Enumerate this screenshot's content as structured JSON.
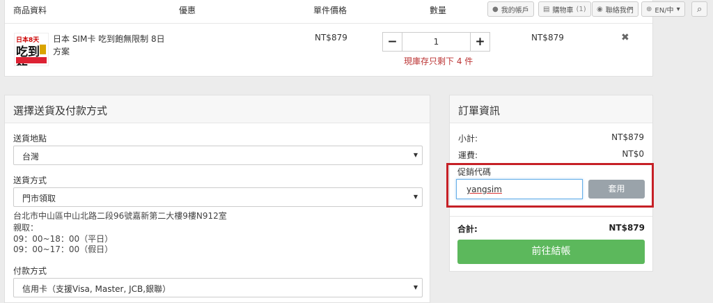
{
  "cart": {
    "columns": [
      "商品資料",
      "優惠",
      "單件價格",
      "數量"
    ],
    "item": {
      "thumb_text_top": "日本8天",
      "thumb_text_big": "吃到飽",
      "name_line1": "日本 SIM卡 吃到飽無限制 8日",
      "name_line2": "方案",
      "unit_price": "NT$879",
      "quantity": "1",
      "stock_note": "現庫存只剩下 4 件",
      "subtotal": "NT$879",
      "minus": "−",
      "plus": "+",
      "remove": "✖"
    }
  },
  "topnav": {
    "account": "我的帳戶",
    "cart": "購物車",
    "cart_count": "(1)",
    "contact": "聯絡我們",
    "lang": "EN/中",
    "lang_caret": "▾",
    "search_icon": "⌕"
  },
  "shipping": {
    "title": "選擇送貨及付款方式",
    "destination_label": "送貨地點",
    "destination_value": "台灣",
    "method_label": "送貨方式",
    "method_value": "門市領取",
    "address": "台北市中山區中山北路二段96號嘉新第二大樓9樓N912室",
    "pickup_label": "親取：",
    "hours_weekday": "09：00~18：00（平日）",
    "hours_holiday": "09：00~17：00（假日）",
    "payment_label": "付款方式",
    "payment_value": "信用卡（支援Visa, Master, JCB,銀聯）",
    "caret": "▼"
  },
  "order": {
    "title": "訂單資訊",
    "subtotal_label": "小計:",
    "subtotal_value": "NT$879",
    "shipping_label": "運費:",
    "shipping_value": "NT$0",
    "promo_label": "促銷代碼",
    "promo_value": "yangsim",
    "apply_label": "套用",
    "total_label": "合計:",
    "total_value": "NT$879",
    "checkout_label": "前往結帳"
  },
  "colors": {
    "highlight": "#c62026",
    "checkout": "#5cb85c",
    "apply": "#9aa3aa"
  }
}
